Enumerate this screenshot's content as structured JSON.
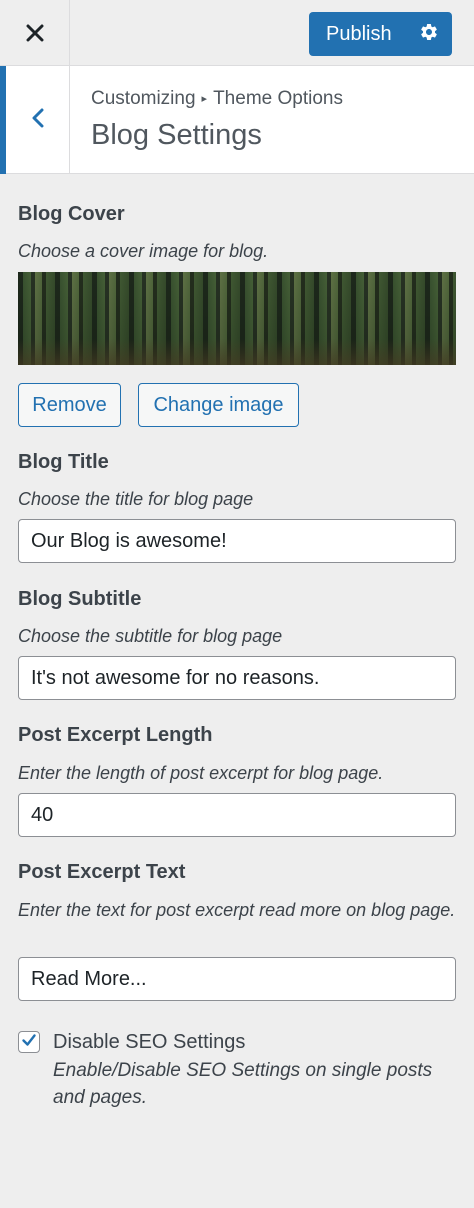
{
  "header": {
    "close_icon": "close-icon",
    "publish_label": "Publish",
    "settings_icon": "gear-icon",
    "accent_color": "#2271b1"
  },
  "section": {
    "back_icon": "chevron-left-icon",
    "breadcrumb_root": "Customizing",
    "breadcrumb_separator": "▸",
    "breadcrumb_parent": "Theme Options",
    "title": "Blog Settings"
  },
  "controls": {
    "blog_cover": {
      "label": "Blog Cover",
      "description": "Choose a cover image for blog.",
      "remove_label": "Remove",
      "change_label": "Change image"
    },
    "blog_title": {
      "label": "Blog Title",
      "description": "Choose the title for blog page",
      "value": "Our Blog is awesome!"
    },
    "blog_subtitle": {
      "label": "Blog Subtitle",
      "description": "Choose the subtitle for blog page",
      "value": "It's not awesome for no reasons."
    },
    "excerpt_length": {
      "label": "Post Excerpt Length",
      "description": "Enter the length of post excerpt for blog page.",
      "value": "40"
    },
    "excerpt_text": {
      "label": "Post Excerpt Text",
      "description": "Enter the text for post excerpt read more on blog page.",
      "value": "Read More..."
    },
    "disable_seo": {
      "label": "Disable SEO Settings",
      "description": "Enable/Disable SEO Settings on single posts and pages.",
      "checked": true
    }
  }
}
